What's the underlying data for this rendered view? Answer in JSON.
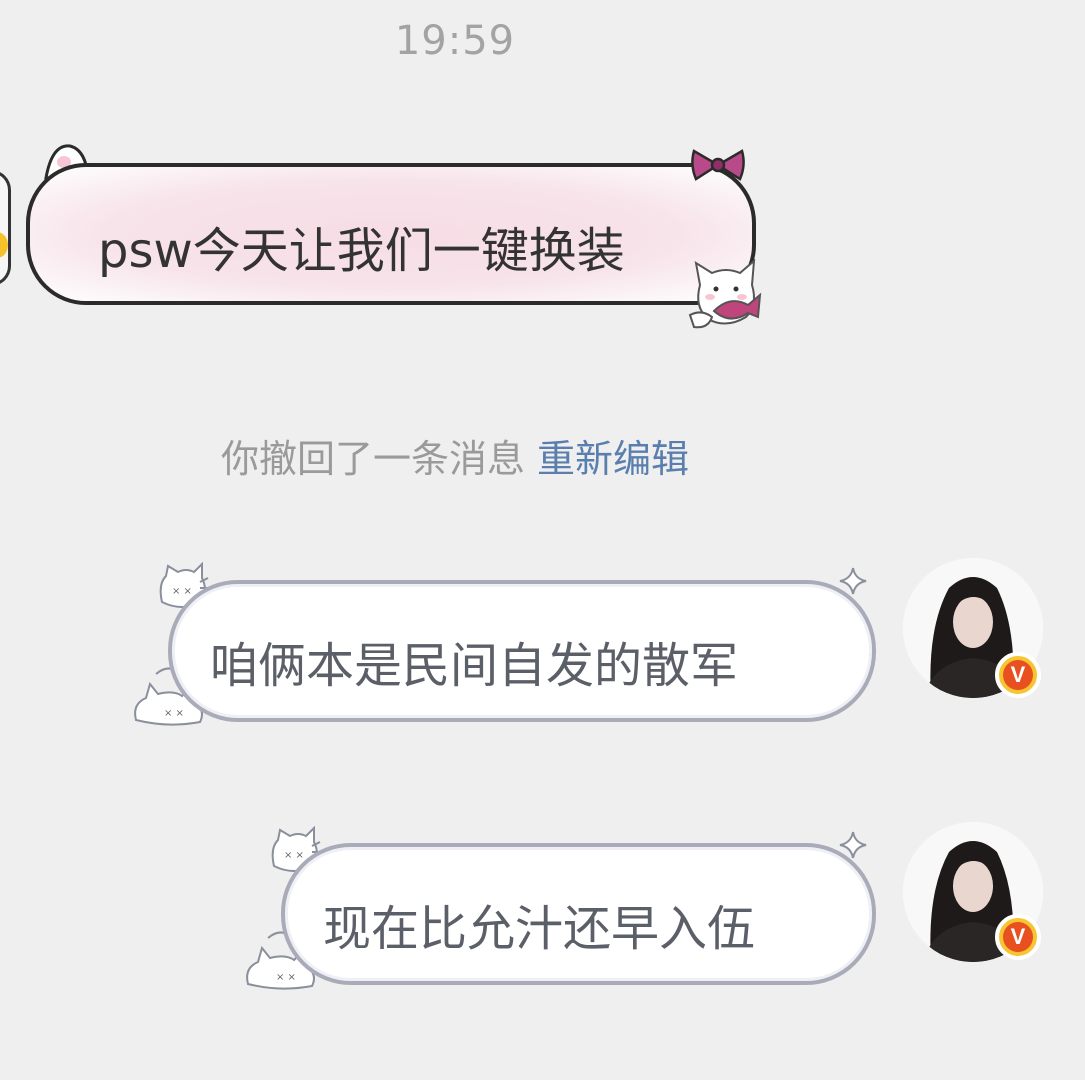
{
  "status": {
    "time": "19:59"
  },
  "messages": [
    {
      "direction": "incoming",
      "text": "psw今天让我们一键换装"
    },
    {
      "direction": "system",
      "text": "你撤回了一条消息",
      "action_label": "重新编辑"
    },
    {
      "direction": "outgoing",
      "text": "咱俩本是民间自发的散军"
    },
    {
      "direction": "outgoing",
      "text": "现在比允汁还早入伍"
    }
  ],
  "badge": {
    "letter": "V"
  },
  "colors": {
    "background": "#efefef",
    "incoming_bubble": "#f7e3ea",
    "outgoing_bubble_border": "#a9acb8",
    "link": "#5a7fae",
    "badge_outer": "#f7c531",
    "badge_inner": "#e8501f"
  }
}
